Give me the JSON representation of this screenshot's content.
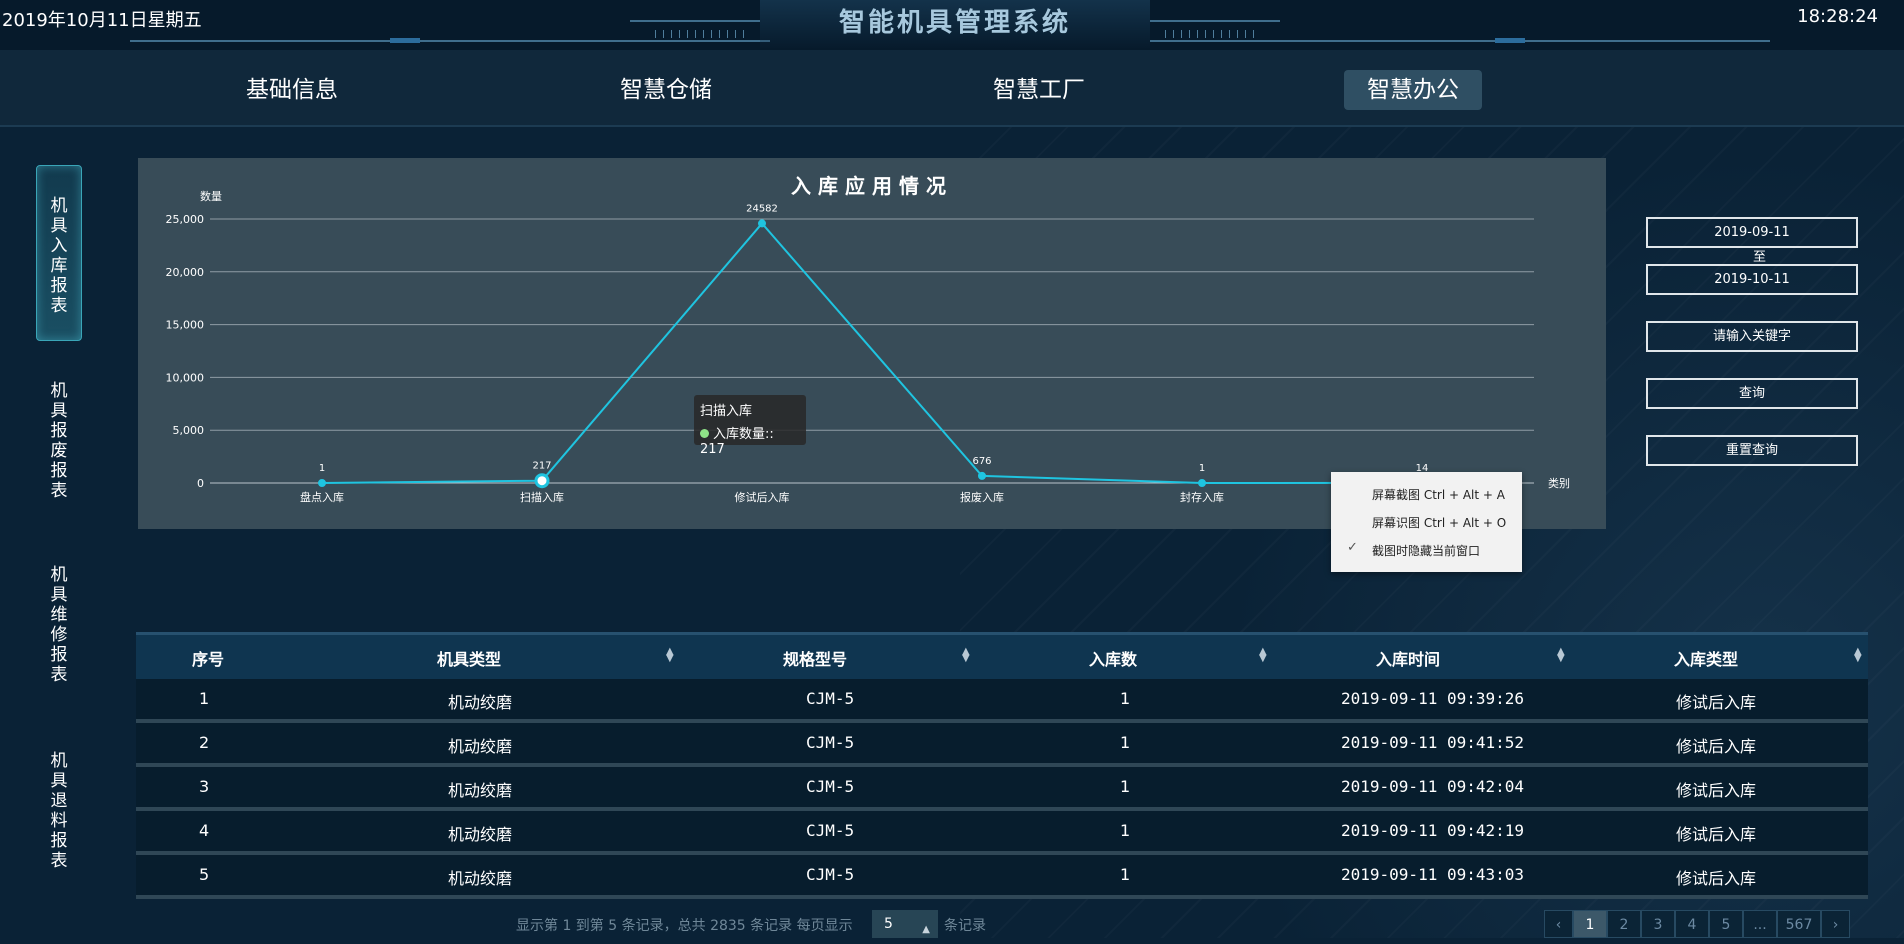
{
  "header": {
    "date": "2019年10月11日星期五",
    "title": "智能机具管理系统",
    "time": "18:28:24"
  },
  "nav": {
    "items": [
      "基础信息",
      "智慧仓储",
      "智慧工厂",
      "智慧办公"
    ],
    "active_index": 3
  },
  "sidebar": {
    "items": [
      "机具入库报表",
      "机具报废报表",
      "机具维修报表",
      "机具退料报表"
    ],
    "active_index": 0
  },
  "chart_data": {
    "type": "line",
    "title": "入库应用情况",
    "ylabel": "数量",
    "xlabel": "类别",
    "categories": [
      "盘点入库",
      "扫描入库",
      "修试后入库",
      "报废入库",
      "封存入库"
    ],
    "series": [
      {
        "name": "入库数量:",
        "values": [
          1,
          217,
          24582,
          676,
          1,
          14
        ],
        "color": "#1fc4e0"
      }
    ],
    "ylim": [
      0,
      25000
    ],
    "yticks": [
      "0",
      "5,000",
      "10,000",
      "15,000",
      "20,000",
      "25,000"
    ],
    "grid": true
  },
  "tooltip": {
    "category": "扫描入库",
    "series_label": "入库数量::",
    "value": "217"
  },
  "context_menu": {
    "items": [
      "屏幕截图 Ctrl + Alt + A",
      "屏幕识图 Ctrl + Alt + O",
      "截图时隐藏当前窗口"
    ],
    "check_glyph": "✓"
  },
  "filter": {
    "date_start": "2019-09-11",
    "to_label": "至",
    "date_end": "2019-10-11",
    "keyword_placeholder": "请输入关键字",
    "query_label": "查询",
    "reset_label": "重置查询"
  },
  "table": {
    "columns": [
      "序号",
      "机具类型",
      "规格型号",
      "入库数",
      "入库时间",
      "入库类型"
    ],
    "rows": [
      [
        "1",
        "机动绞磨",
        "CJM-5",
        "1",
        "2019-09-11 09:39:26",
        "修试后入库"
      ],
      [
        "2",
        "机动绞磨",
        "CJM-5",
        "1",
        "2019-09-11 09:41:52",
        "修试后入库"
      ],
      [
        "3",
        "机动绞磨",
        "CJM-5",
        "1",
        "2019-09-11 09:42:04",
        "修试后入库"
      ],
      [
        "4",
        "机动绞磨",
        "CJM-5",
        "1",
        "2019-09-11 09:42:19",
        "修试后入库"
      ],
      [
        "5",
        "机动绞磨",
        "CJM-5",
        "1",
        "2019-09-11 09:43:03",
        "修试后入库"
      ]
    ]
  },
  "pagination": {
    "info": "显示第 1 到第 5 条记录，总共 2835 条记录 每页显示",
    "page_size": "5",
    "suffix": "条记录",
    "pages": [
      "‹",
      "1",
      "2",
      "3",
      "4",
      "5",
      "...",
      "567",
      "›"
    ],
    "active_page": "1"
  },
  "colors": {
    "background": "#0a2236",
    "chart_panel": "#384c58",
    "line": "#1fc4e0",
    "table_header": "#0f3550"
  }
}
